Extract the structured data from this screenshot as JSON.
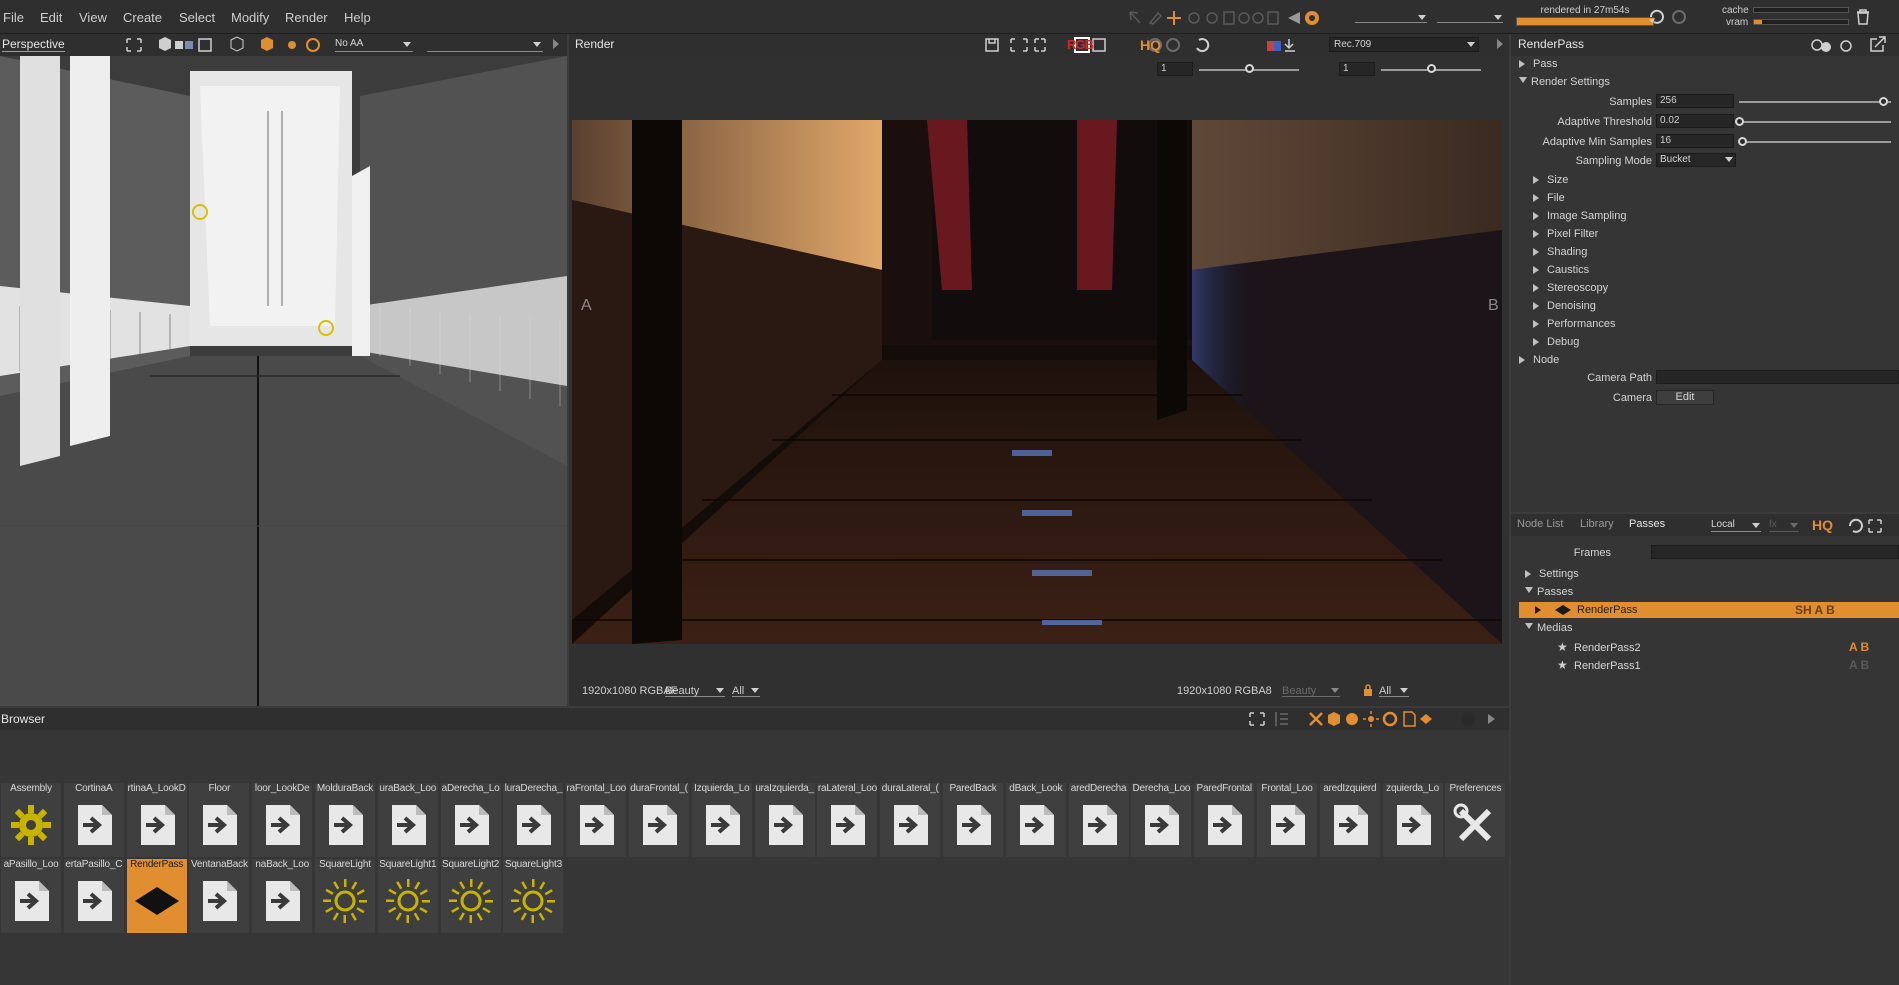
{
  "menu": [
    "File",
    "Edit",
    "View",
    "Create",
    "Select",
    "Modify",
    "Render",
    "Help"
  ],
  "status": {
    "render_time": "rendered in 27m54s",
    "cache_label": "cache",
    "vram_label": "vram"
  },
  "viewport": {
    "title": "Perspective",
    "aa_mode": "No AA"
  },
  "render": {
    "title": "Render",
    "colorspace": "Rec.709",
    "exposure_a": "1",
    "exposure_b": "1",
    "label_a": "A",
    "label_b": "B",
    "left_info": "1920x1080 RGBAF",
    "left_pass": "Beauty",
    "left_layer": "All",
    "right_info": "1920x1080 RGBA8",
    "right_pass": "Beauty",
    "right_layer": "All",
    "hq": "HQ",
    "rgb": "RGB"
  },
  "inspector": {
    "title": "RenderPass",
    "sections": {
      "pass": "Pass",
      "render_settings": "Render Settings",
      "node": "Node"
    },
    "settings": [
      {
        "label": "Samples",
        "value": "256"
      },
      {
        "label": "Adaptive Threshold",
        "value": "0.02"
      },
      {
        "label": "Adaptive Min Samples",
        "value": "16"
      }
    ],
    "sampling_mode_label": "Sampling Mode",
    "sampling_mode": "Bucket",
    "groups": [
      "Size",
      "File",
      "Image Sampling",
      "Pixel Filter",
      "Shading",
      "Caustics",
      "Stereoscopy",
      "Denoising",
      "Performances",
      "Debug"
    ],
    "camera_path_label": "Camera Path",
    "camera_label": "Camera",
    "edit_label": "Edit"
  },
  "passes_panel": {
    "tabs": [
      "Node List",
      "Library",
      "Passes"
    ],
    "scope": "Local",
    "fx": "fx",
    "hq": "HQ",
    "frames_label": "Frames",
    "tree": {
      "settings": "Settings",
      "passes": "Passes",
      "renderpass": "RenderPass",
      "medias": "Medias"
    },
    "medias": [
      "RenderPass2",
      "RenderPass1"
    ],
    "flags": "SH A B",
    "media_flags": [
      "A B",
      "A B"
    ]
  },
  "browser": {
    "title": "Browser",
    "row1": [
      "Assembly",
      "CortinaA",
      "rtinaA_LookD",
      "Floor",
      "loor_LookDe",
      "MolduraBack",
      "uraBack_Loo",
      "aDerecha_Lo",
      "luraDerecha_",
      "raFrontal_Loo",
      "duraFrontal_(",
      "Izquierda_Lo",
      "uraIzquierda_",
      "raLateral_Loo",
      "duraLateral_(",
      "ParedBack",
      "dBack_Look",
      "aredDerecha",
      "Derecha_Loo",
      "ParedFrontal",
      "Frontal_Loo",
      "aredIzquierd",
      "zquierda_Lo",
      "Preferences"
    ],
    "row2": [
      "aPasillo_Loo",
      "ertaPasillo_C",
      "RenderPass",
      "VentanaBack",
      "naBack_Loo",
      "SquareLight",
      "SquareLight1",
      "SquareLight2",
      "SquareLight3"
    ]
  },
  "colors": {
    "accent": "#e08e30",
    "panel": "#353535",
    "menubar": "#2f2f2f",
    "icon_yellow": "#c8b400"
  }
}
